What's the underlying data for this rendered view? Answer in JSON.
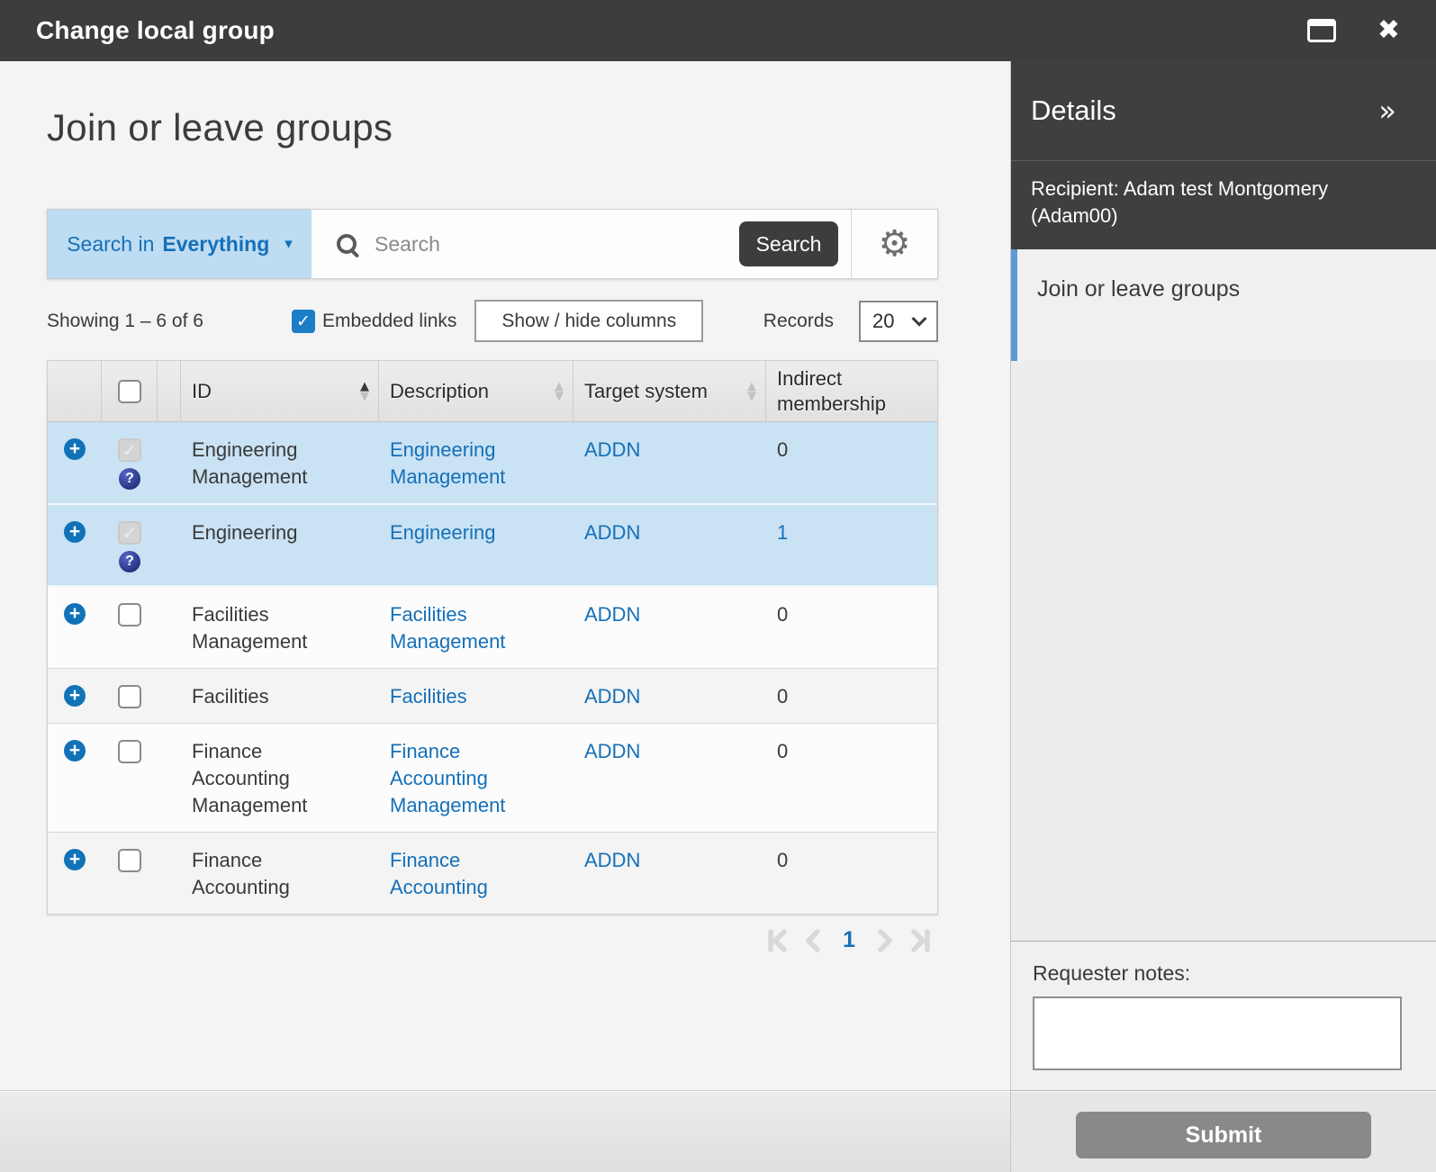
{
  "titlebar": {
    "title": "Change local group"
  },
  "main": {
    "page_title": "Join or leave groups",
    "search": {
      "scope_prefix": "Search in",
      "scope_value": "Everything",
      "placeholder": "Search",
      "button_label": "Search"
    },
    "controls": {
      "showing": "Showing 1 – 6 of 6",
      "embedded_links_label": "Embedded links",
      "embedded_links_checked": true,
      "show_hide_label": "Show / hide columns",
      "records_label": "Records",
      "records_value": "20"
    },
    "table": {
      "columns": [
        {
          "label": "ID",
          "sort": "asc"
        },
        {
          "label": "Description",
          "sort": "none"
        },
        {
          "label": "Target system",
          "sort": "none"
        },
        {
          "label": "Indirect membership",
          "sort": "hidden"
        }
      ],
      "rows": [
        {
          "id": "Engineering Management",
          "description": "Engineering Management",
          "target_system": "ADDN",
          "indirect_membership": "0",
          "indirect_is_link": false,
          "selected": true,
          "checkbox": "disabled-checked",
          "help_icon": true
        },
        {
          "id": "Engineering",
          "description": "Engineering",
          "target_system": "ADDN",
          "indirect_membership": "1",
          "indirect_is_link": true,
          "selected": true,
          "checkbox": "disabled-checked",
          "help_icon": true
        },
        {
          "id": "Facilities Management",
          "description": "Facilities Management",
          "target_system": "ADDN",
          "indirect_membership": "0",
          "indirect_is_link": false,
          "selected": false,
          "checkbox": "unchecked",
          "help_icon": false
        },
        {
          "id": "Facilities",
          "description": "Facilities",
          "target_system": "ADDN",
          "indirect_membership": "0",
          "indirect_is_link": false,
          "selected": false,
          "checkbox": "unchecked",
          "help_icon": false
        },
        {
          "id": "Finance Accounting Management",
          "description": "Finance Accounting Management",
          "target_system": "ADDN",
          "indirect_membership": "0",
          "indirect_is_link": false,
          "selected": false,
          "checkbox": "unchecked",
          "help_icon": false
        },
        {
          "id": "Finance Accounting",
          "description": "Finance Accounting",
          "target_system": "ADDN",
          "indirect_membership": "0",
          "indirect_is_link": false,
          "selected": false,
          "checkbox": "unchecked",
          "help_icon": false
        }
      ]
    },
    "pagination": {
      "current_page": "1"
    }
  },
  "sidebar": {
    "details_title": "Details",
    "recipient": "Recipient: Adam test Montgomery (Adam00)",
    "selected_item": "Join or leave groups",
    "requester_notes_label": "Requester notes:",
    "notes_value": "",
    "submit_label": "Submit"
  },
  "colors": {
    "titlebar": "#3d3d3d",
    "accent_blue": "#1570b8",
    "row_highlight": "#c9e2f4",
    "scope_background": "#bedcf2",
    "selected_item_bar": "#5b9bd5",
    "submit_gray": "#898989"
  }
}
